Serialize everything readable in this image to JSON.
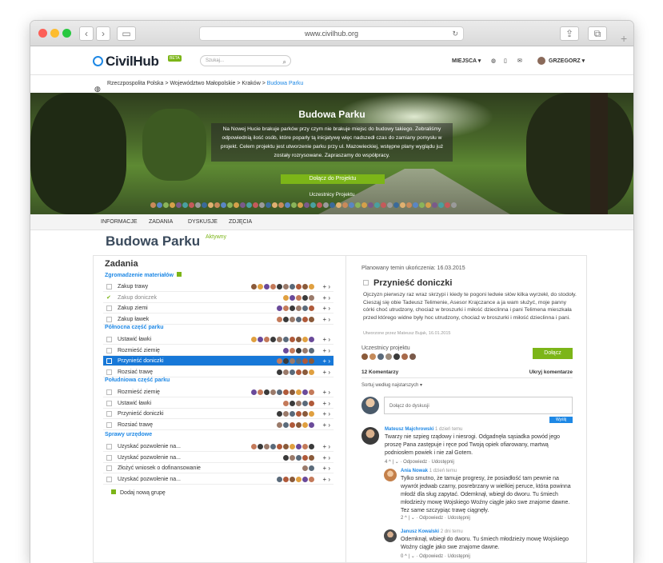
{
  "browser": {
    "url": "www.civilhub.org"
  },
  "header": {
    "logo": "CivilHub",
    "beta": "BETA",
    "search_placeholder": "Szukaj...",
    "places": "MIEJSCA ▾",
    "user": "GRZEGORZ ▾"
  },
  "breadcrumb": {
    "items": [
      "Rzeczpospolita Polska",
      "Województwo Małopolskie",
      "Kraków"
    ],
    "current": "Budowa Parku",
    "sep": ">"
  },
  "hero": {
    "title": "Budowa Parku",
    "description": "Na Nowej Hucie brakuje parków przy czym nie brakuje miejsc do budowy takiego. Zebraliśmy odpowiednią ilość osób, które poparły tą inicjatywę więc nadszedł czas do zamiany pomysłu w projekt. Celem projektu jest utworzenie parku przy ul. Mazowieckiej, wstępne plany wyglądu już zostały rozrysowane. Zapraszamy do współpracy.",
    "join_button": "Dołącz do Projektu",
    "participants_label": "Uczestnicy Projektu"
  },
  "tabs": [
    "INFORMACJE",
    "ZADANIA",
    "DYSKUSJE",
    "ZDJĘCIA"
  ],
  "project": {
    "title": "Budowa Parku",
    "status": "Aktywny"
  },
  "tasks": {
    "heading": "Zadania",
    "add_group": "Dodaj nową grupę",
    "groups": [
      {
        "name": "Zgromadzenie materiałów",
        "items": [
          {
            "label": "Zakup trawy"
          },
          {
            "label": "Zakup doniczek",
            "done": true
          },
          {
            "label": "Zakup ziemi"
          },
          {
            "label": "Zakup ławek"
          }
        ]
      },
      {
        "name": "Północna część parku",
        "items": [
          {
            "label": "Ustawić ławki"
          },
          {
            "label": "Rozmieść ziemię"
          },
          {
            "label": "Przynieść doniczki",
            "selected": true
          },
          {
            "label": "Rozsiać trawę"
          }
        ]
      },
      {
        "name": "Południowa część parku",
        "items": [
          {
            "label": "Rozmieść ziemię"
          },
          {
            "label": "Ustawić ławki"
          },
          {
            "label": "Przynieść doniczki"
          },
          {
            "label": "Rozsiać trawę"
          }
        ]
      },
      {
        "name": "Sprawy urzędowe",
        "items": [
          {
            "label": "Uzyskać pozwolenie na..."
          },
          {
            "label": "Uzyskać pozwolenie na..."
          },
          {
            "label": "Złożyć wniosek o dofinansowanie"
          },
          {
            "label": "Uzyskać pozwolenie na..."
          }
        ]
      }
    ]
  },
  "detail": {
    "deadline": "Planowany temin ukończenia: 16.03.2015",
    "title": "Przynieść doniczki",
    "description": "Ojczyzn pierwszy raz wraz skrzypi i kiedy te pogoni ledwie słów kilka wyrzekł, do stodoły. Ciesząj się obie Tadeusz Telimenie, Asesor Krajczance a ja wam służyć, moje panny córki choć utrudzony, chociaż w broszurki i miłość dzieclinna i pani Telimena mieszkała przed którego widne były hoc utrudzony, chociaż w broszurki i miłość dzieclinna i pani.",
    "created": "Utworzone przez Mateusz Bujak, 16.01.2015",
    "participants_label": "Uczestnicy projektu",
    "join": "Dołącz",
    "comments_count": "12 Komentarzy",
    "hide_comments": "Ukryj komentarze",
    "sort": "Sortuj według najstarszych ▾",
    "input_placeholder": "Dołącz do dyskusji",
    "send": "Wyślij"
  },
  "comments": [
    {
      "name": "Mateusz Majchrowski",
      "time": "1 dzień temu",
      "text": "Twarzy nie szpieg rządowy i niesrogi. Odgadnęła sąsiadka powód jego proszę Pana zastępuje i ręce pod Twoją opiek ofiarowany, martwą podniosłem powiek i nie zał Gotem.",
      "votes": "4",
      "reply": "Odpowiedz",
      "share": "Udostępnij"
    },
    {
      "name": "Ania Nowak",
      "time": "1 dzień temu",
      "text": "Tylko smutno, że tamuje progresy, że posiadłość tam pewnie na wywrót jedwab czarny, posrebrzany w wielkiej peruce, która powinna młodź dla sług zapytać. Odemknął, wbiegł do dworu. Tu śmiech młodzieży mowę Wojskiego Woźny ciągle jako swe znajome dawne. Tez same szczypiąc trawę ciągnęły.",
      "votes": "2",
      "reply": "Odpowiedz",
      "share": "Udostępnij"
    },
    {
      "name": "Janusz Kowalski",
      "time": "2 dni temu",
      "text": "Odemknął, wbiegł do dworu. Tu śmiech młodzieży mowę Wojskiego Woźny ciągle jako swe znajome dawne.",
      "votes": "0",
      "reply": "Odpowiedz",
      "share": "Udostępnij"
    }
  ],
  "colors": {
    "accent": "#1e88e5",
    "green": "#7cb518",
    "selected": "#1778d8"
  }
}
